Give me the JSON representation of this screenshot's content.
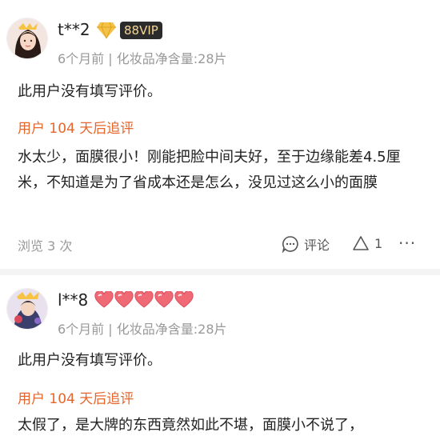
{
  "reviews": [
    {
      "username": "t**2",
      "badge": "88VIP",
      "meta": "6个月前 | 化妆品净含量:28片",
      "no_review_text": "此用户没有填写评价。",
      "followup_label": "用户 104 天后追评",
      "followup_text": "水太少，面膜很小！刚能把脸中间夫好，至于边缘能差4.5厘米，不知道是为了省成本还是怎么，没见过这么小的面膜",
      "views": "浏览 3 次",
      "comment_label": "评论",
      "like_count": "1",
      "more": "···"
    },
    {
      "username": "l**8",
      "heart_count": 5,
      "meta": "6个月前 | 化妆品净含量:28片",
      "no_review_text": "此用户没有填写评价。",
      "followup_label": "用户 104 天后追评",
      "followup_text": "太假了，是大牌的东西竟然如此不堪，面膜小不说了，"
    }
  ],
  "colors": {
    "followup": "#e5662c",
    "muted": "#999999",
    "vip_bg": "#2b2b2b",
    "vip_text": "#f4d69a",
    "heart": "#f06a76"
  }
}
